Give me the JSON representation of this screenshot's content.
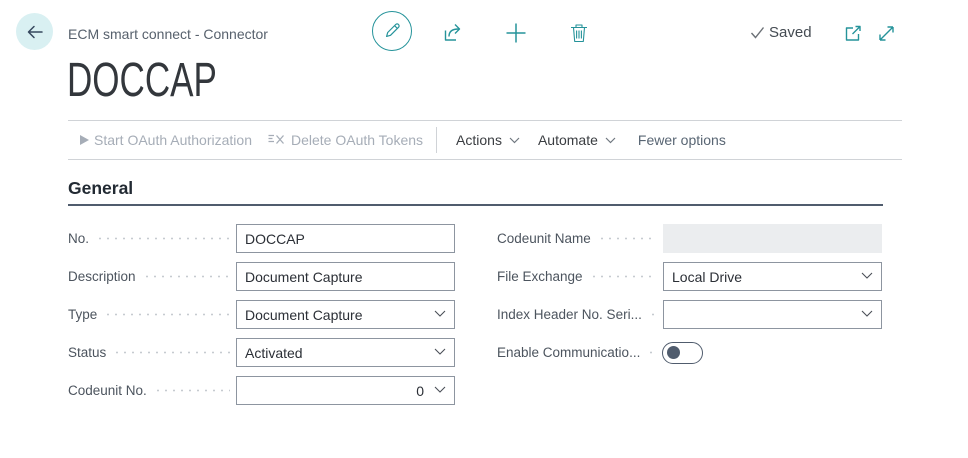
{
  "accent_color": "#0e8288",
  "header": {
    "breadcrumb": "ECM smart connect - Connector",
    "saved_label": "Saved"
  },
  "page_title": "DOCCAP",
  "action_bar": {
    "start_oauth": "Start OAuth Authorization",
    "delete_tokens": "Delete OAuth Tokens",
    "actions": "Actions",
    "automate": "Automate",
    "fewer_options": "Fewer options"
  },
  "section": {
    "title": "General",
    "fields_left": [
      {
        "label": "No.",
        "value": "DOCCAP",
        "type": "text"
      },
      {
        "label": "Description",
        "value": "Document Capture",
        "type": "text"
      },
      {
        "label": "Type",
        "value": "Document Capture",
        "type": "select"
      },
      {
        "label": "Status",
        "value": "Activated",
        "type": "select"
      },
      {
        "label": "Codeunit No.",
        "value": "0",
        "type": "select"
      }
    ],
    "fields_right": [
      {
        "label": "Codeunit Name",
        "value": "",
        "type": "disabled"
      },
      {
        "label": "File Exchange",
        "value": "Local Drive",
        "type": "select"
      },
      {
        "label": "Index Header No. Seri...",
        "value": "",
        "type": "select"
      },
      {
        "label": "Enable Communicatio...",
        "value": "off",
        "type": "toggle"
      }
    ]
  }
}
